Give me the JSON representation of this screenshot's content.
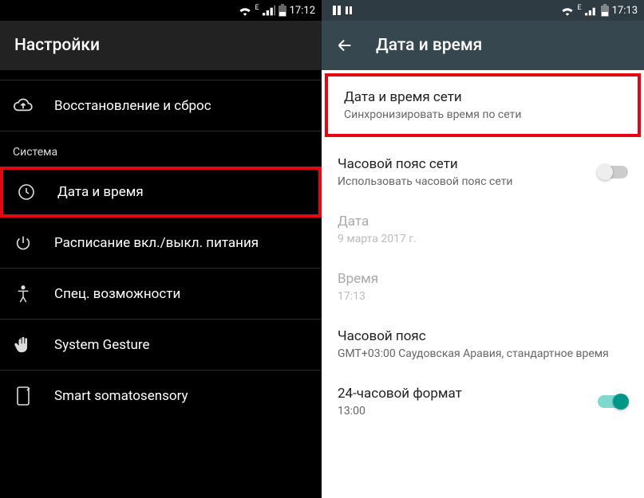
{
  "left": {
    "statusbar": {
      "net_tag": "E",
      "time": "17:12"
    },
    "appbar_title": "Настройки",
    "items": {
      "backup": "Восстановление и сброс",
      "section_system": "Система",
      "datetime": "Дата и время",
      "schedule": "Расписание вкл./выкл. питания",
      "accessibility": "Спец. возможности",
      "gesture": "System Gesture",
      "somato": "Smart somatosensory"
    }
  },
  "right": {
    "statusbar": {
      "net_tag": "E",
      "time": "17:13"
    },
    "appbar_title": "Дата и время",
    "settings": {
      "net_time_title": "Дата и время сети",
      "net_time_sub": "Синхронизировать время по сети",
      "net_tz_title": "Часовой пояс сети",
      "net_tz_sub": "Использовать часовой пояс сети",
      "date_title": "Дата",
      "date_sub": "9 марта 2017 г.",
      "time_title": "Время",
      "time_sub": "17:13",
      "tz_title": "Часовой пояс",
      "tz_sub": "GMT+03:00 Саудовская Аравия, стандартное время",
      "h24_title": "24-часовой формат",
      "h24_sub": "13:00"
    }
  }
}
